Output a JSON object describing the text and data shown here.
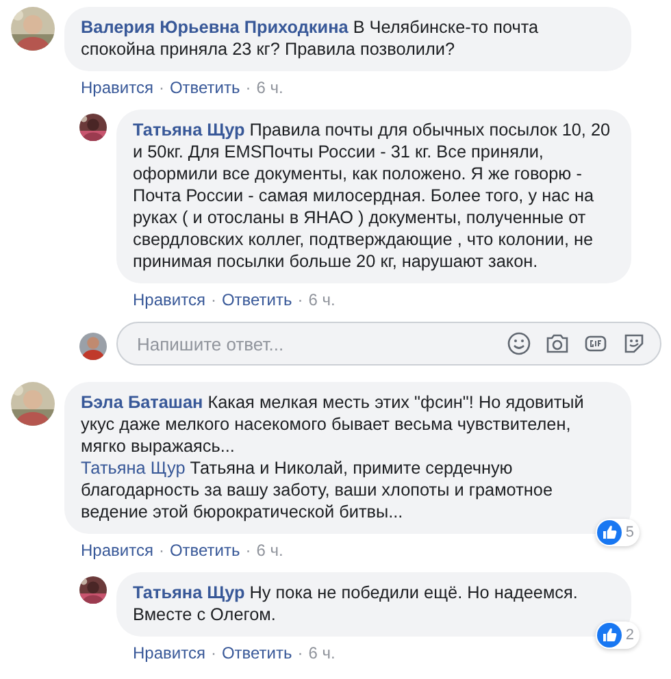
{
  "separator": "·",
  "comments": [
    {
      "reply": false,
      "author": "Валерия Юрьевна Приходкина",
      "text": "В Челябинске-то почта спокойна приняла 23 кг? Правила позволили?",
      "actions": [
        "Нравится",
        "Ответить",
        "6 ч."
      ]
    },
    {
      "reply": true,
      "author": "Татьяна Щур",
      "text": "Правила почты для обычных посылок 10, 20 и 50кг. Для EMSПочты России - 31 кг. Все приняли, оформили все документы, как положено. Я же говорю - Почта России - самая милосердная. Более того, у нас на руках ( и отосланы в ЯНАО ) документы, полученные от свердловских коллег, подтверждающие , что колонии, не принимая посылки больше 20 кг, нарушают закон.",
      "actions": [
        "Нравится",
        "Ответить",
        "6 ч."
      ],
      "reply_box": {
        "placeholder": "Напишите ответ..."
      }
    },
    {
      "reply": false,
      "author": "Бэла Баташан",
      "text": "Какая мелкая месть этих \"фсин\"! Но ядовитый укус даже мелкого насекомого бывает весьма чувствителен, мягко выражаясь...",
      "quote": {
        "mention": "Татьяна Щур",
        "text": "Татьяна и Николай, примите сердечную благодарность за вашу заботу, ваши хлопоты и грамотное ведение этой бюрократической битвы..."
      },
      "likes": "5",
      "actions": [
        "Нравится",
        "Ответить",
        "6 ч."
      ]
    },
    {
      "reply": true,
      "author": "Татьяна Щур",
      "text": "Ну пока не победили ещё. Но надеемся. Вместе с Олегом.",
      "likes": "2",
      "actions": [
        "Нравится",
        "Ответить",
        "6 ч."
      ]
    }
  ]
}
